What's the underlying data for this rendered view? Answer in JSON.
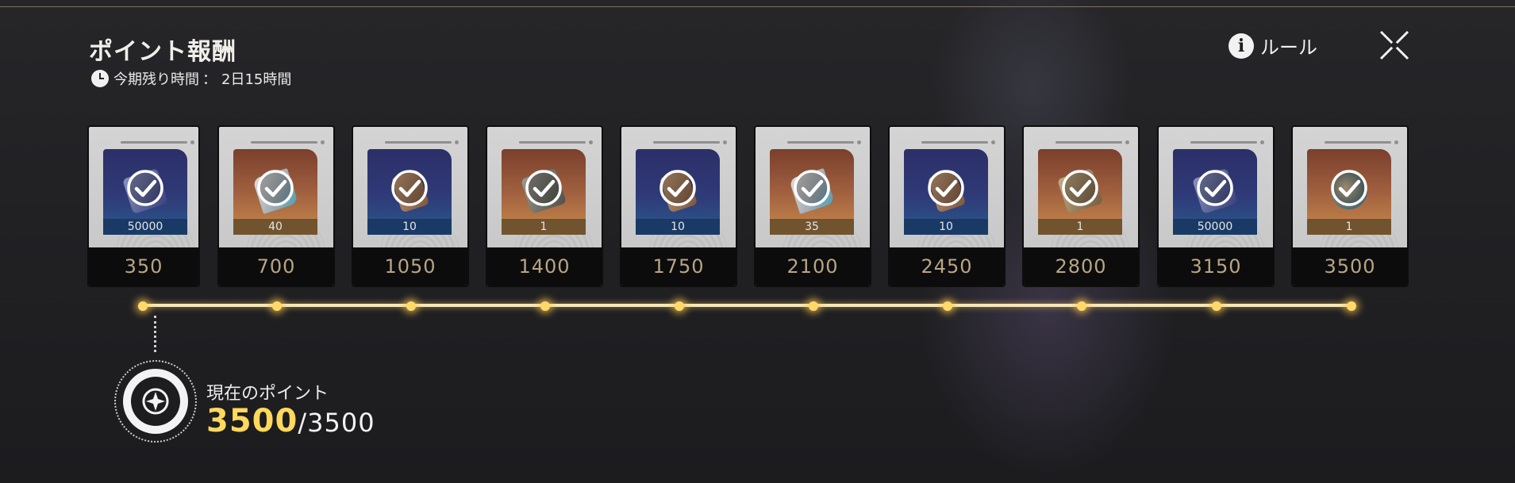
{
  "header": {
    "title": "ポイント報酬",
    "timer_label": "今期残り時間",
    "timer_sep": "：",
    "timer_value": "2日15時間",
    "rules_label": "ルール",
    "rules_icon": "info-icon",
    "close_icon": "close-icon"
  },
  "rewards": [
    {
      "points": "350",
      "qty": "50000",
      "theme": "blue",
      "icon": "card-icon",
      "claimed": true
    },
    {
      "points": "700",
      "qty": "40",
      "theme": "orange",
      "icon": "crystal-icon",
      "claimed": true
    },
    {
      "points": "1050",
      "qty": "10",
      "theme": "blue",
      "icon": "scroll-icon",
      "claimed": true
    },
    {
      "points": "1400",
      "qty": "1",
      "theme": "orange",
      "icon": "device-icon",
      "claimed": true
    },
    {
      "points": "1750",
      "qty": "10",
      "theme": "blue",
      "icon": "scroll-icon",
      "claimed": true
    },
    {
      "points": "2100",
      "qty": "35",
      "theme": "orange",
      "icon": "crystal-icon",
      "claimed": true
    },
    {
      "points": "2450",
      "qty": "10",
      "theme": "blue",
      "icon": "scroll-icon",
      "claimed": true
    },
    {
      "points": "2800",
      "qty": "1",
      "theme": "orange",
      "icon": "case-icon",
      "claimed": true
    },
    {
      "points": "3150",
      "qty": "50000",
      "theme": "blue",
      "icon": "card-icon",
      "claimed": true
    },
    {
      "points": "3500",
      "qty": "1",
      "theme": "orange",
      "icon": "orb-icon",
      "claimed": true
    }
  ],
  "progress": {
    "label": "現在のポイント",
    "current": "3500",
    "total": "/3500",
    "fraction": 1.0,
    "medal_icon": "compass-emblem-icon"
  },
  "colors": {
    "accent_gold": "#ffd85c",
    "points_text": "#b9a583",
    "track": "#f6e8b8"
  }
}
